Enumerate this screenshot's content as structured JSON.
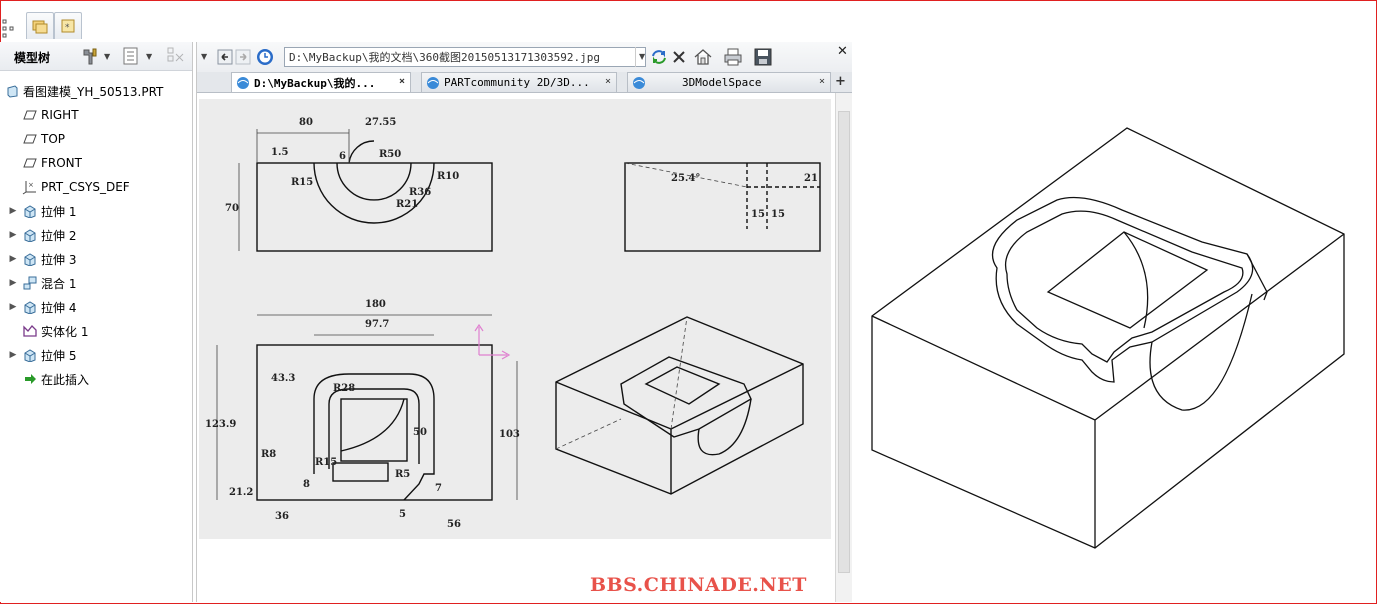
{
  "tree": {
    "title": "模型树",
    "items": [
      {
        "label": "看图建模_YH_50513.PRT",
        "icon": "part-icon",
        "expandable": false,
        "indent": 0
      },
      {
        "label": "RIGHT",
        "icon": "datum-plane-icon",
        "expandable": false,
        "indent": 1
      },
      {
        "label": "TOP",
        "icon": "datum-plane-icon",
        "expandable": false,
        "indent": 1
      },
      {
        "label": "FRONT",
        "icon": "datum-plane-icon",
        "expandable": false,
        "indent": 1
      },
      {
        "label": "PRT_CSYS_DEF",
        "icon": "csys-icon",
        "expandable": false,
        "indent": 1
      },
      {
        "label": "拉伸 1",
        "icon": "extrude-icon",
        "expandable": true,
        "indent": 1
      },
      {
        "label": "拉伸 2",
        "icon": "extrude-icon",
        "expandable": true,
        "indent": 1
      },
      {
        "label": "拉伸 3",
        "icon": "extrude-icon",
        "expandable": true,
        "indent": 1
      },
      {
        "label": "混合 1",
        "icon": "blend-icon",
        "expandable": true,
        "indent": 1
      },
      {
        "label": "拉伸 4",
        "icon": "extrude-icon",
        "expandable": true,
        "indent": 1
      },
      {
        "label": "实体化 1",
        "icon": "solidify-icon",
        "expandable": false,
        "indent": 1
      },
      {
        "label": "拉伸 5",
        "icon": "extrude-icon",
        "expandable": true,
        "indent": 1
      },
      {
        "label": "在此插入",
        "icon": "insert-arrow-icon",
        "expandable": false,
        "indent": 1
      }
    ]
  },
  "browser": {
    "address": "D:\\MyBackup\\我的文档\\360截图20150513171303592.jpg",
    "tabs": [
      {
        "label": "D:\\MyBackup\\我的...",
        "active": true
      },
      {
        "label": "PARTcommunity 2D/3D...",
        "active": false
      },
      {
        "label": "3DModelSpace",
        "active": false
      }
    ],
    "add_tab": "+",
    "close_tab": "×"
  },
  "drawing": {
    "dims": [
      "80",
      "27.55",
      "R50",
      "1.5",
      "6",
      "R15",
      "R36",
      "R10",
      "R21",
      "70",
      "25.4°",
      "21",
      "15",
      "15",
      "180",
      "97.7",
      "43.3",
      "R28",
      "123.9",
      "50",
      "103",
      "R8",
      "R15",
      "R5",
      "8",
      "21.2",
      "36",
      "5",
      "7",
      "56"
    ]
  },
  "watermark": "BBS.CHINADE.NET",
  "colors": {
    "frame": "#e02020",
    "watermark": "#e8524a",
    "csys": "#e080d0",
    "insert": "#2a9a2a"
  }
}
